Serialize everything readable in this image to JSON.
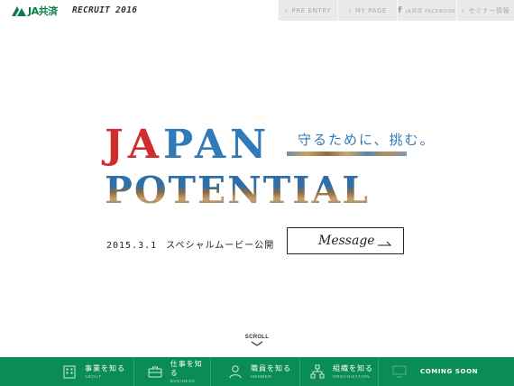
{
  "header": {
    "logo_text": "JA共済",
    "recruit_label": "RECRUIT 2016",
    "nav": {
      "pre_entry": "PRE ENTRY",
      "my_page": "MY PAGE",
      "facebook": "JA共済 FACEBOOK",
      "seminar": "セミナー情報"
    }
  },
  "hero": {
    "title_line1_red": "JA",
    "title_line1_blue": "PAN",
    "title_line2": "POTENTIAL",
    "tagline": "守るために、挑む。",
    "release_date": "2015.3.1",
    "release_text": "スペシャルムービー公開",
    "message_button": "Message"
  },
  "scroll_label": "SCROLL",
  "bottom_nav": {
    "items": [
      {
        "jp": "事業を知る",
        "en": "ABOUT"
      },
      {
        "jp": "仕事を知る",
        "en": "BUSINESS"
      },
      {
        "jp": "職員を知る",
        "en": "MEMBER"
      },
      {
        "jp": "組織を知る",
        "en": "ORGANIZATION"
      }
    ],
    "coming_soon": "COMING SOON"
  },
  "colors": {
    "brand_green": "#0a8c56",
    "title_red": "#d32c2c",
    "title_blue": "#2f7bb9",
    "topnav_bg": "#e9eaea"
  }
}
